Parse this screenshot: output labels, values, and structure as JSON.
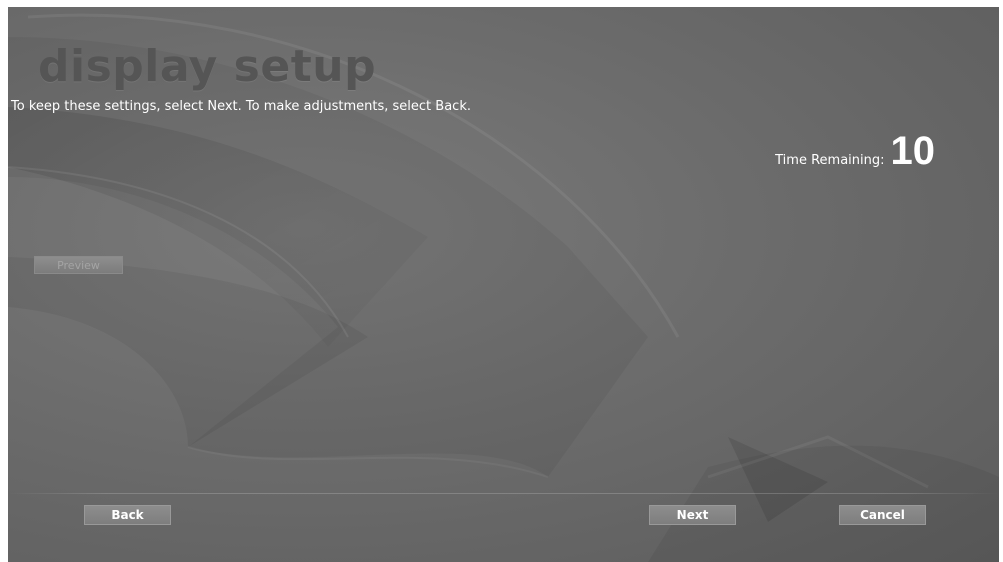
{
  "header": {
    "title": "display setup",
    "instruction": "To keep these settings, select Next. To make adjustments, select Back."
  },
  "timer": {
    "label": "Time Remaining:",
    "value": "10"
  },
  "preview": {
    "label": "Preview"
  },
  "footer": {
    "back_label": "Back",
    "next_label": "Next",
    "cancel_label": "Cancel"
  },
  "colors": {
    "background": "#6c6c6c",
    "title": "#555555",
    "text": "#ffffff",
    "button": "#858585"
  }
}
